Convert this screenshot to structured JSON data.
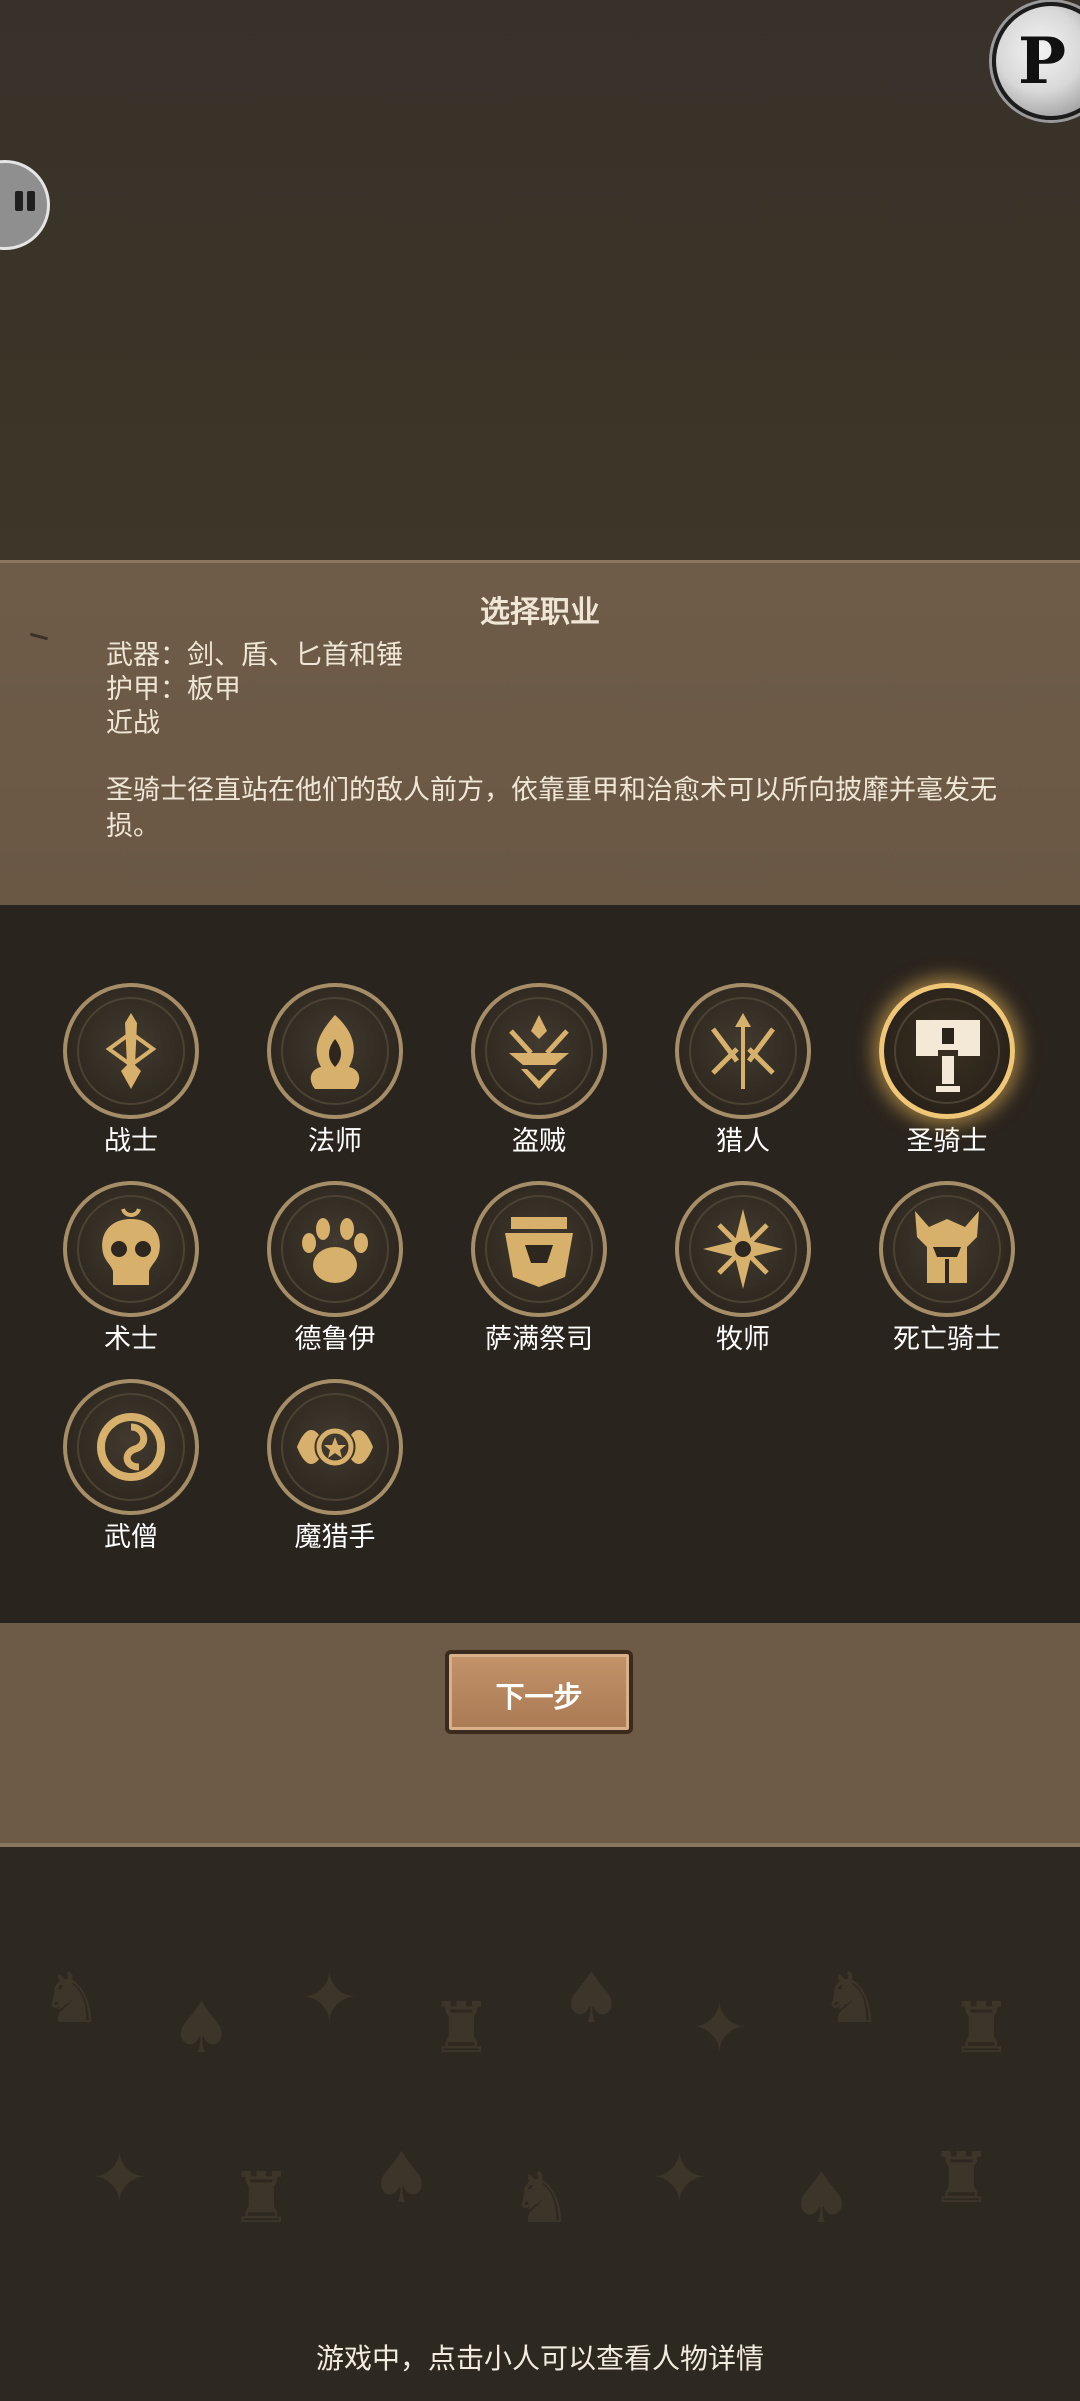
{
  "overlay": {
    "corner_badge_letter": "P",
    "pause_icon": "pause-icon"
  },
  "info": {
    "title": "选择职业",
    "weapons": "武器：剑、盾、匕首和锤",
    "armor": "护甲：板甲",
    "range": "近战",
    "description": "圣骑士径直站在他们的敌人前方，依靠重甲和治愈术可以所向披靡并毫发无损。"
  },
  "classes": [
    {
      "label": "战士",
      "icon": "sword-emblem-icon",
      "selected": false
    },
    {
      "label": "法师",
      "icon": "flame-emblem-icon",
      "selected": false
    },
    {
      "label": "盗贼",
      "icon": "daggers-emblem-icon",
      "selected": false
    },
    {
      "label": "猎人",
      "icon": "arrows-emblem-icon",
      "selected": false
    },
    {
      "label": "圣骑士",
      "icon": "hammer-emblem-icon",
      "selected": true
    },
    {
      "label": "术士",
      "icon": "skull-emblem-icon",
      "selected": false
    },
    {
      "label": "德鲁伊",
      "icon": "paw-emblem-icon",
      "selected": false
    },
    {
      "label": "萨满祭司",
      "icon": "totem-emblem-icon",
      "selected": false
    },
    {
      "label": "牧师",
      "icon": "star-emblem-icon",
      "selected": false
    },
    {
      "label": "死亡骑士",
      "icon": "helm-emblem-icon",
      "selected": false
    },
    {
      "label": "武僧",
      "icon": "swirl-emblem-icon",
      "selected": false
    },
    {
      "label": "魔猎手",
      "icon": "demon-eye-emblem-icon",
      "selected": false
    }
  ],
  "actions": {
    "next_label": "下一步"
  },
  "footer": {
    "hint": "游戏中，点击小人可以查看人物详情"
  },
  "colors": {
    "gold_accent": "#d7b06b",
    "selected_glow": "#f0c777",
    "panel_brown": "#6d5b48"
  }
}
